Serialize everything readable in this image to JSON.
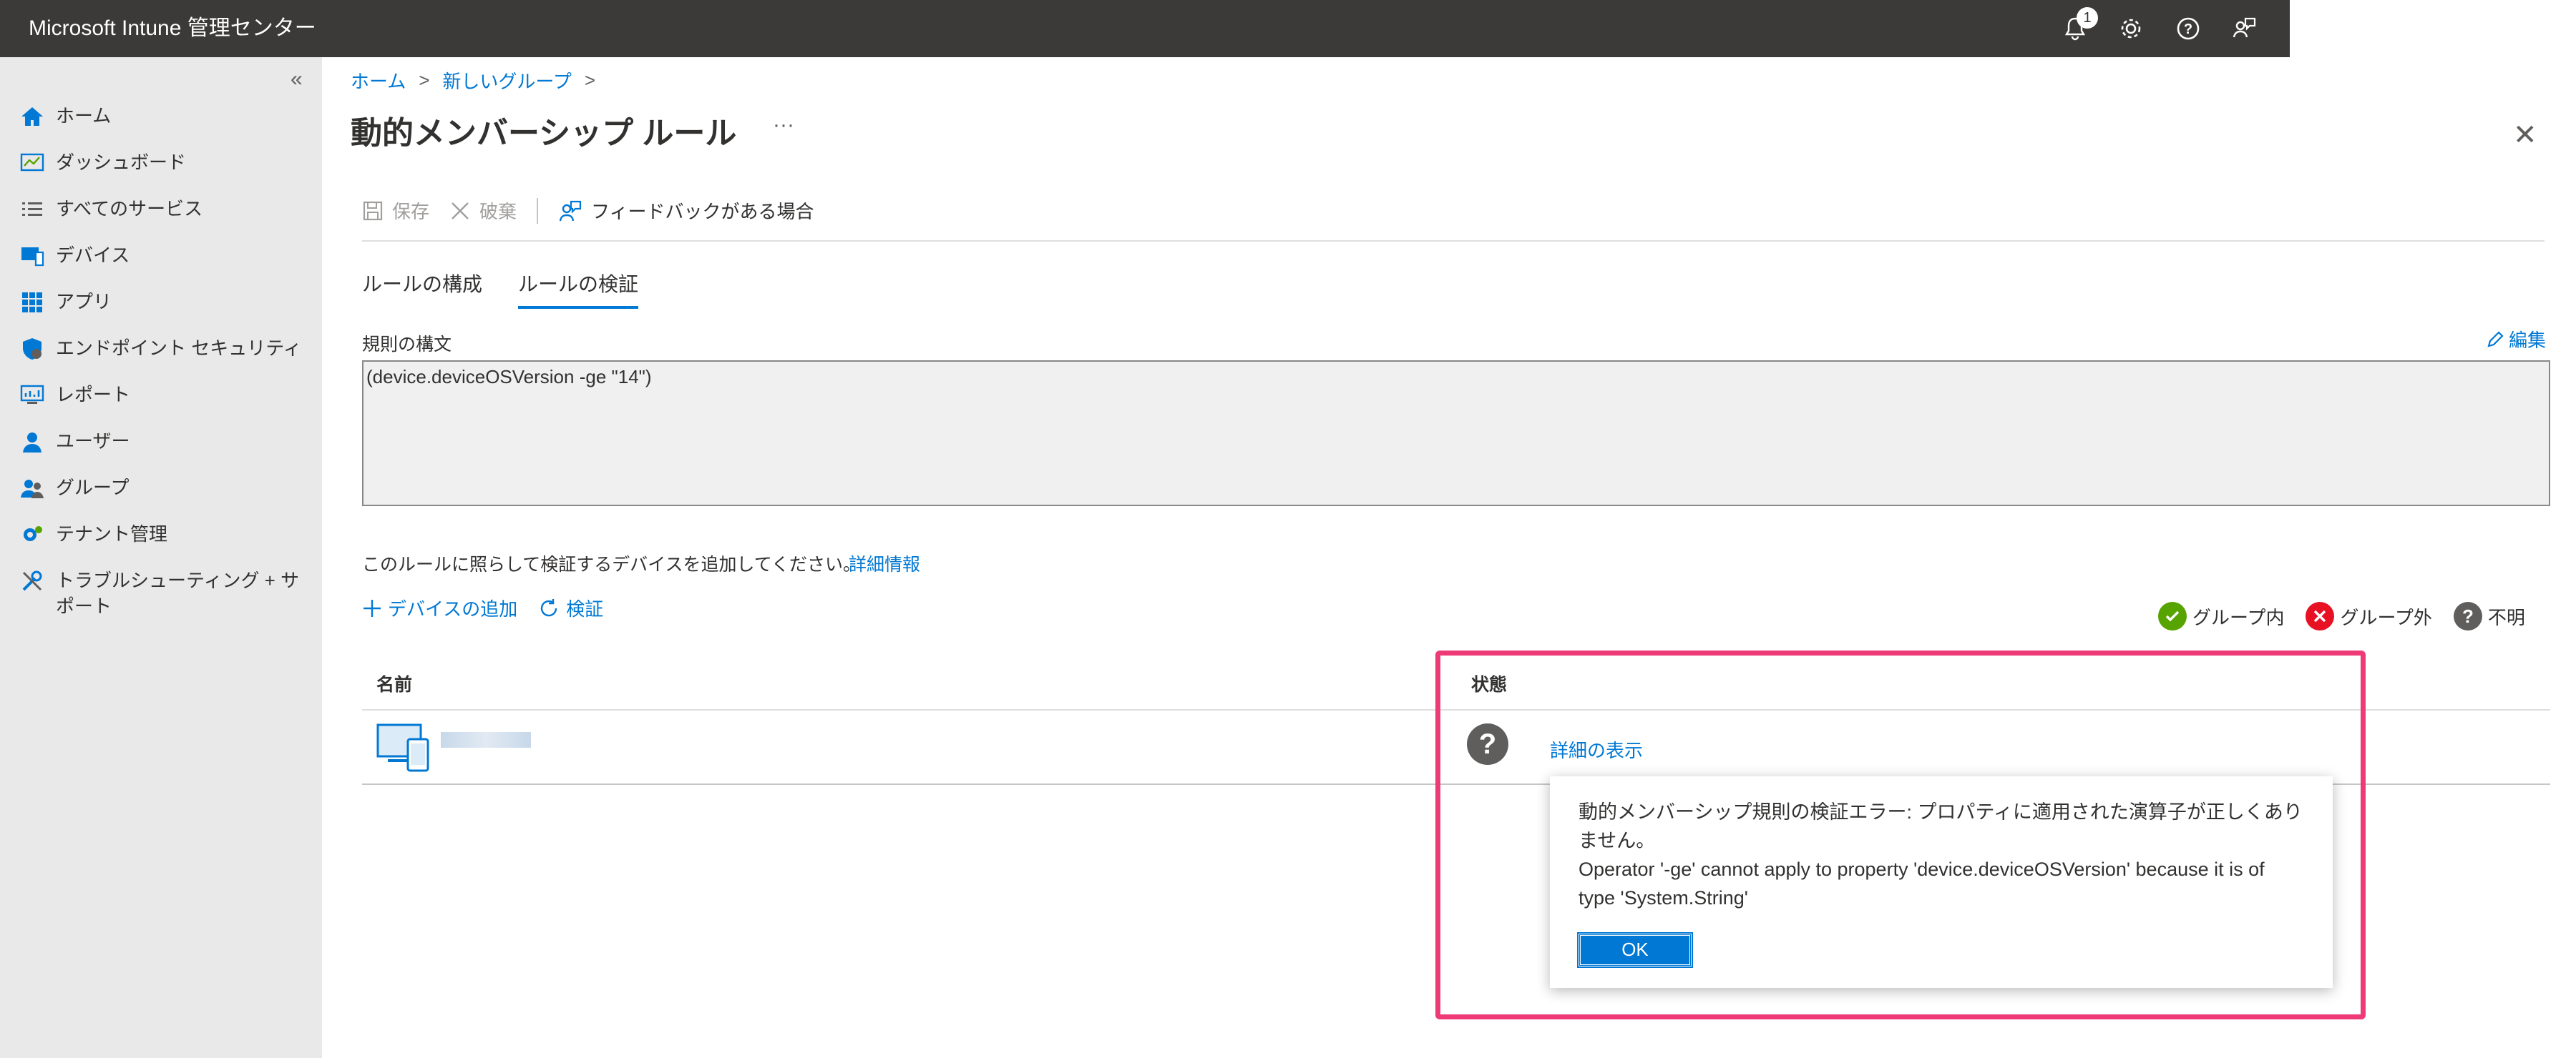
{
  "app": {
    "title": "Microsoft Intune 管理センター",
    "notification_count": "1"
  },
  "sidebar": {
    "collapse_label": "«",
    "items": [
      {
        "label": "ホーム",
        "icon": "home-icon"
      },
      {
        "label": "ダッシュボード",
        "icon": "dashboard-icon"
      },
      {
        "label": "すべてのサービス",
        "icon": "list-icon"
      },
      {
        "label": "デバイス",
        "icon": "device-icon"
      },
      {
        "label": "アプリ",
        "icon": "apps-grid-icon"
      },
      {
        "label": "エンドポイント セキュリティ",
        "icon": "shield-icon"
      },
      {
        "label": "レポート",
        "icon": "report-icon"
      },
      {
        "label": "ユーザー",
        "icon": "user-icon"
      },
      {
        "label": "グループ",
        "icon": "group-icon"
      },
      {
        "label": "テナント管理",
        "icon": "tenant-gear-icon"
      },
      {
        "label": "トラブルシューティング + サポート",
        "icon": "wrench-icon"
      }
    ]
  },
  "breadcrumb": {
    "home": "ホーム",
    "group": "新しいグループ",
    "sep": ">"
  },
  "page": {
    "title": "動的メンバーシップ ルール",
    "more": "···",
    "close": "✕"
  },
  "toolbar": {
    "save": "保存",
    "discard": "破棄",
    "feedback": "フィードバックがある場合"
  },
  "tabs": [
    {
      "label": "ルールの構成"
    },
    {
      "label": "ルールの検証"
    }
  ],
  "rule": {
    "syntax_label": "規則の構文",
    "edit": "編集",
    "syntax": "(device.deviceOSVersion -ge \"14\")"
  },
  "validation": {
    "hint": "このルールに照らして検証するデバイスを追加してください。",
    "more_info": "詳細情報",
    "add_device": "デバイスの追加",
    "validate": "検証"
  },
  "legend": {
    "in_group": "グループ内",
    "out_group": "グループ外",
    "unknown": "不明"
  },
  "table": {
    "col_name": "名前",
    "col_status": "状態",
    "detail_link": "詳細の表示"
  },
  "popup": {
    "line1": "動的メンバーシップ規則の検証エラー: プロパティに適用された演算子が正しくありません。",
    "line2": "Operator '-ge' cannot apply to property 'device.deviceOSVersion' because it is of type 'System.String'",
    "ok": "OK"
  },
  "colors": {
    "accent": "#0078d4",
    "highlight": "#ee3b78",
    "topbar": "#3b3a39",
    "success": "#57a300",
    "error": "#e81123"
  }
}
